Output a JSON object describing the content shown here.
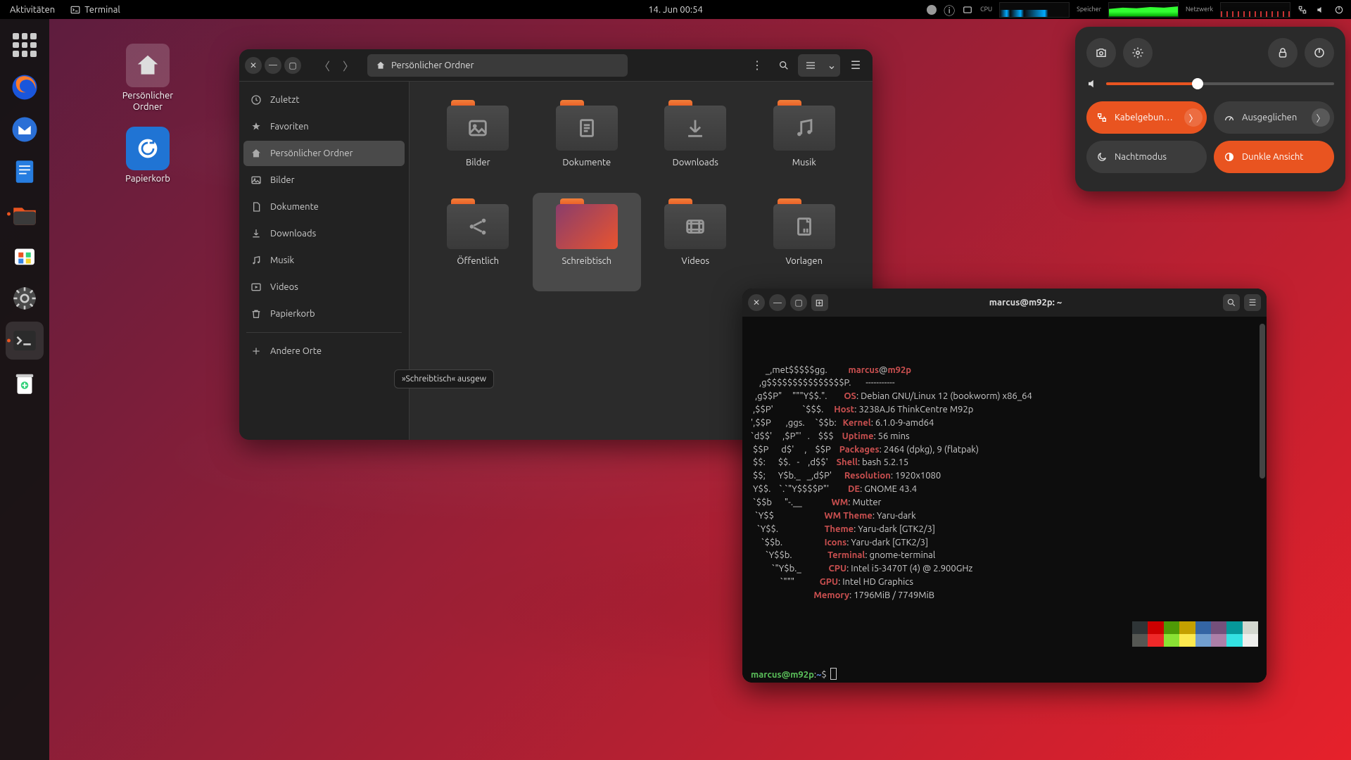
{
  "topbar": {
    "activities": "Aktivitäten",
    "app_name": "Terminal",
    "datetime": "14. Jun  00:54",
    "labels": {
      "cpu": "CPU",
      "mem": "Speicher",
      "net": "Netzwerk"
    }
  },
  "desktop": {
    "home_label": "Persönlicher\nOrdner",
    "trash_label": "Papierkorb"
  },
  "files": {
    "path_label": "Persönlicher Ordner",
    "sidebar": [
      "Zuletzt",
      "Favoriten",
      "Persönlicher Ordner",
      "Bilder",
      "Dokumente",
      "Downloads",
      "Musik",
      "Videos",
      "Papierkorb",
      "Andere Orte"
    ],
    "folders": [
      {
        "name": "Bilder",
        "icon": "image"
      },
      {
        "name": "Dokumente",
        "icon": "doc"
      },
      {
        "name": "Downloads",
        "icon": "download"
      },
      {
        "name": "Musik",
        "icon": "music"
      },
      {
        "name": "Öffentlich",
        "icon": "share"
      },
      {
        "name": "Schreibtisch",
        "icon": "desktop",
        "selected": true
      },
      {
        "name": "Videos",
        "icon": "video"
      },
      {
        "name": "Vorlagen",
        "icon": "template"
      }
    ],
    "tooltip": "»Schreibtisch« ausgew"
  },
  "terminal": {
    "title": "marcus@m92p: ~",
    "user": "marcus",
    "host": "m92p",
    "prompt_path": "~",
    "ascii": [
      "       _,met$$$$$gg.",
      "    ,g$$$$$$$$$$$$$$$P.",
      "  ,g$$P\"     \"\"\"Y$$.\".",
      " ,$$P'              `$$$.",
      "',$$P       ,ggs.     `$$b:",
      "`d$$'     ,$P\"'   .    $$$",
      " $$P      d$'     ,    $$P",
      " $$:      $$.   -    ,d$$'",
      " $$;      Y$b._   _,d$P'",
      " Y$$.    `.`\"Y$$$$P\"'",
      " `$$b      \"-.__",
      "  `Y$$",
      "   `Y$$.",
      "     `$$b.",
      "       `Y$$b.",
      "          `\"Y$b._",
      "              `\"\"\""
    ],
    "info": [
      {
        "k": "OS",
        "v": "Debian GNU/Linux 12 (bookworm) x86_64"
      },
      {
        "k": "Host",
        "v": "3238AJ6 ThinkCentre M92p"
      },
      {
        "k": "Kernel",
        "v": "6.1.0-9-amd64"
      },
      {
        "k": "Uptime",
        "v": "56 mins"
      },
      {
        "k": "Packages",
        "v": "2464 (dpkg), 9 (flatpak)"
      },
      {
        "k": "Shell",
        "v": "bash 5.2.15"
      },
      {
        "k": "Resolution",
        "v": "1920x1080"
      },
      {
        "k": "DE",
        "v": "GNOME 43.4"
      },
      {
        "k": "WM",
        "v": "Mutter"
      },
      {
        "k": "WM Theme",
        "v": "Yaru-dark"
      },
      {
        "k": "Theme",
        "v": "Yaru-dark [GTK2/3]"
      },
      {
        "k": "Icons",
        "v": "Yaru-dark [GTK2/3]"
      },
      {
        "k": "Terminal",
        "v": "gnome-terminal"
      },
      {
        "k": "CPU",
        "v": "Intel i5-3470T (4) @ 2.900GHz"
      },
      {
        "k": "GPU",
        "v": "Intel HD Graphics"
      },
      {
        "k": "Memory",
        "v": "1796MiB / 7749MiB"
      }
    ],
    "palette_dark": [
      "#2e3436",
      "#cc0000",
      "#4e9a06",
      "#c4a000",
      "#3465a4",
      "#75507b",
      "#06989a",
      "#d3d7cf"
    ],
    "palette_light": [
      "#555753",
      "#ef2929",
      "#8ae234",
      "#fce94f",
      "#729fcf",
      "#ad7fa8",
      "#34e2e2",
      "#eeeeec"
    ]
  },
  "qs": {
    "wired": "Kabelgebun…",
    "power": "Ausgeglichen",
    "night": "Nachtmodus",
    "dark": "Dunkle Ansicht",
    "volume_pct": 40
  }
}
